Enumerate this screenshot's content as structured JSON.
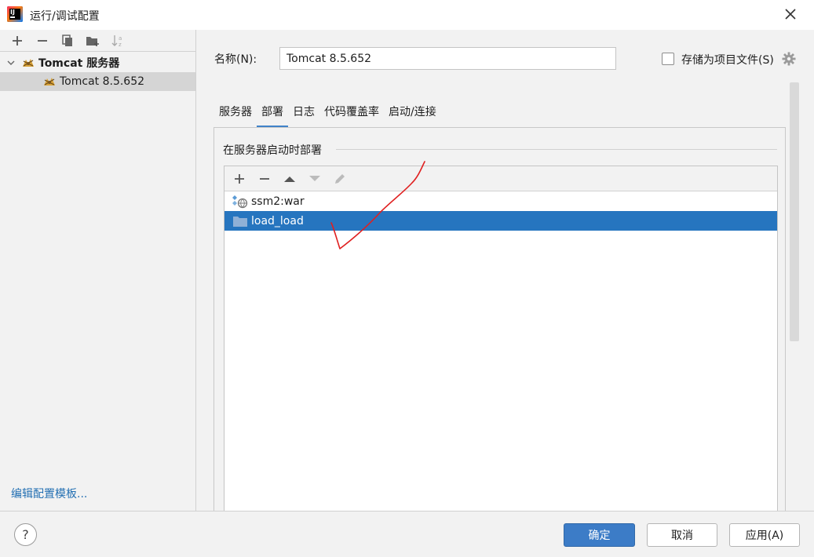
{
  "window": {
    "title": "运行/调试配置",
    "app_icon": "intellij-idea-icon",
    "close_icon": "close-icon"
  },
  "left_toolbar": {
    "buttons": [
      "add-icon",
      "remove-icon",
      "copy-icon",
      "new-folder-icon",
      "sort-icon"
    ]
  },
  "tree": {
    "group_label": "Tomcat 服务器",
    "group_expanded": true,
    "item_label": "Tomcat 8.5.652",
    "selected": "Tomcat 8.5.652"
  },
  "edit_templates_link": "编辑配置模板...",
  "form": {
    "name_label": "名称(N):",
    "name_value": "Tomcat 8.5.652",
    "store_as_project_file_label": "存储为项目文件(S)",
    "store_as_project_file_checked": false
  },
  "tabs": [
    "服务器",
    "部署",
    "日志",
    "代码覆盖率",
    "启动/连接"
  ],
  "active_tab": "部署",
  "deployment": {
    "section_title": "在服务器启动时部署",
    "toolbar_buttons": [
      "add-icon",
      "remove-icon",
      "move-up-icon",
      "move-down-icon",
      "edit-icon"
    ],
    "items": [
      {
        "label": "ssm2:war",
        "icon": "artifact-icon",
        "selected": false
      },
      {
        "label": "load_load",
        "icon": "folder-icon",
        "selected": true
      }
    ]
  },
  "buttons": {
    "help": "?",
    "ok": "确定",
    "cancel": "取消",
    "apply": "应用(A)"
  },
  "colors": {
    "selection_blue": "#2675bf",
    "primary_button": "#3c7cc7",
    "link": "#2470b3",
    "annotation_red": "#e02020"
  }
}
